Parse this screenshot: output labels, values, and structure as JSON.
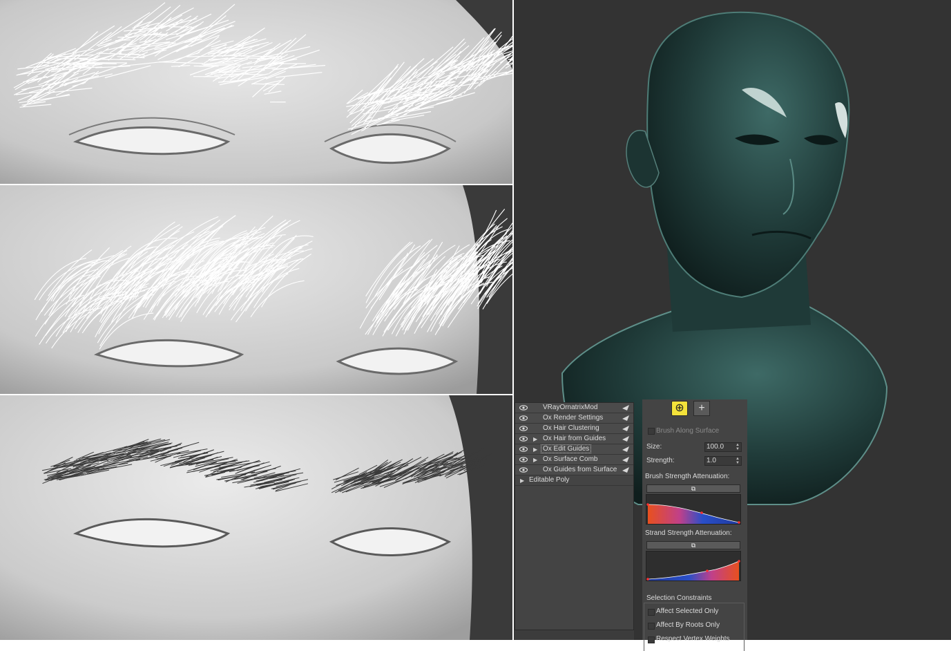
{
  "colors": {
    "viewport_bg": "#333333",
    "stack_bg": "#444444",
    "accent_yellow": "#f4e23a",
    "curve_warm": "#e8501e",
    "curve_cool": "#2a4fc8"
  },
  "modifier_stack": {
    "items": [
      {
        "label": "VRayOrnatrixMod",
        "expandable": false,
        "icon": "eye-icon"
      },
      {
        "label": "Ox Render Settings",
        "expandable": false,
        "icon": "eye-icon"
      },
      {
        "label": "Ox Hair Clustering",
        "expandable": false,
        "icon": "eye-icon"
      },
      {
        "label": "Ox Hair from Guides",
        "expandable": true,
        "icon": "eye-icon"
      },
      {
        "label": "Ox Edit Guides",
        "expandable": true,
        "icon": "eye-icon",
        "selected": true
      },
      {
        "label": "Ox Surface Comb",
        "expandable": true,
        "icon": "eye-icon"
      },
      {
        "label": "Ox Guides from Surface",
        "expandable": false,
        "icon": "eye-icon"
      },
      {
        "label": "Editable Poly",
        "expandable": true,
        "base": true
      }
    ]
  },
  "params": {
    "brush_along_surface": "Brush Along Surface",
    "size_label": "Size:",
    "size_value": "100.0",
    "strength_label": "Strength:",
    "strength_value": "1.0",
    "brush_attenuation_label": "Brush Strength Attenuation:",
    "strand_attenuation_label": "Strand Strength Attenuation:",
    "selection_constraints_label": "Selection Constraints",
    "affect_selected_only": "Affect Selected Only",
    "affect_by_roots_only": "Affect By Roots Only",
    "respect_vertex_weights": "Respect Vertex Weights"
  }
}
